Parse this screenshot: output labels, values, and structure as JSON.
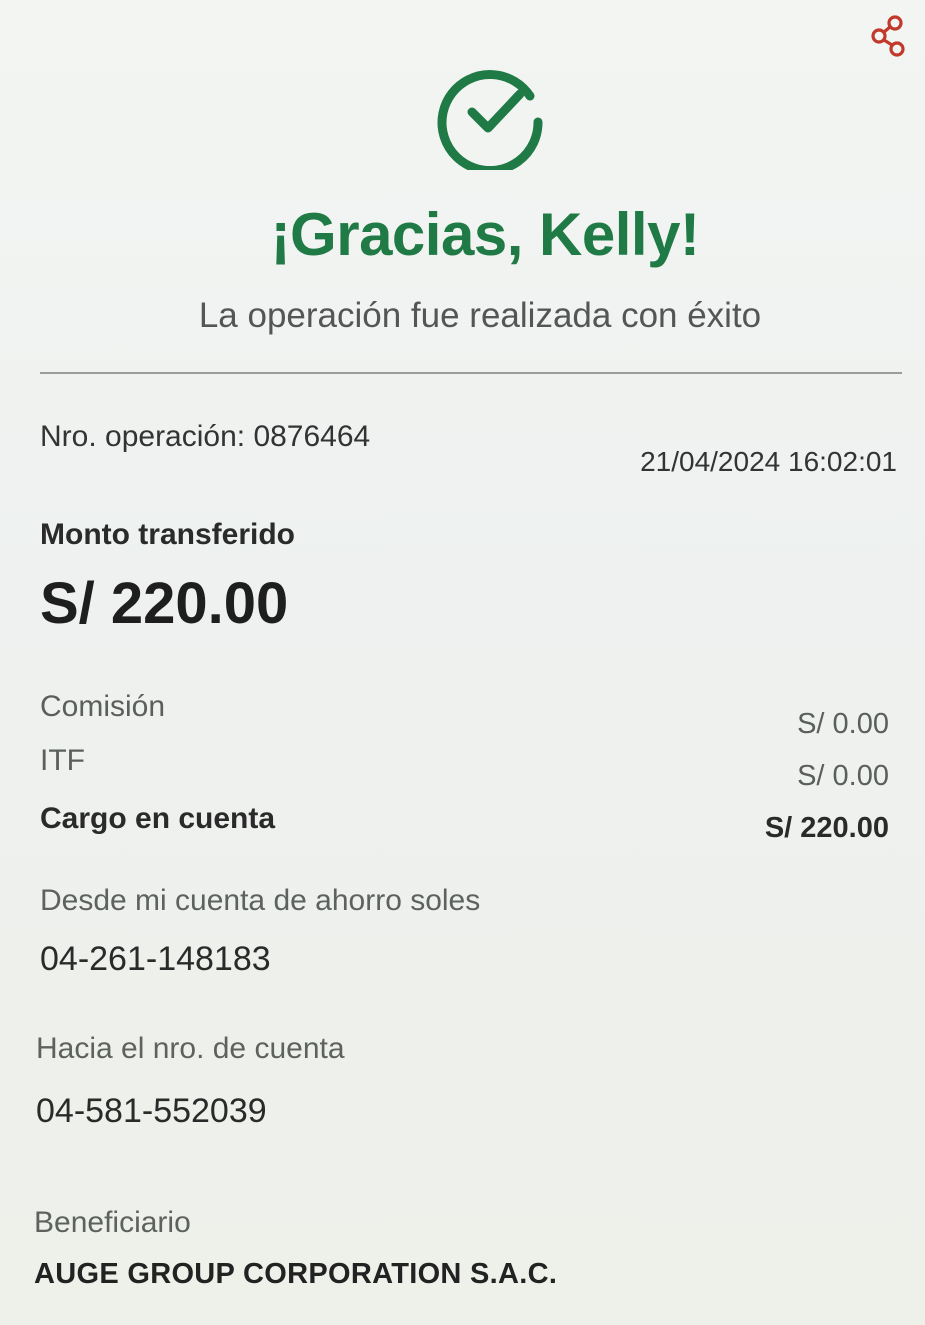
{
  "header": {
    "share_icon": "share-icon",
    "success_icon": "check-circle-icon",
    "title": "¡Gracias, Kelly!",
    "subtitle": "La operación fue realizada con éxito"
  },
  "operation": {
    "number_label": "Nro. operación: 0876464",
    "datetime": "21/04/2024 16:02:01"
  },
  "amount": {
    "label": "Monto transferido",
    "value": "S/ 220.00"
  },
  "fees": [
    {
      "label": "Comisión",
      "value": "S/ 0.00"
    },
    {
      "label": "ITF",
      "value": "S/ 0.00"
    },
    {
      "label": "Cargo en cuenta",
      "value": "S/ 220.00"
    }
  ],
  "from_account": {
    "label": "Desde mi cuenta de ahorro soles",
    "value": "04-261-148183"
  },
  "to_account": {
    "label": "Hacia el nro. de cuenta",
    "value": "04-581-552039"
  },
  "beneficiary": {
    "label": "Beneficiario",
    "value": "AUGE GROUP CORPORATION S.A.C."
  },
  "colors": {
    "brand_green": "#1f7a45",
    "share_red": "#c0392b"
  }
}
